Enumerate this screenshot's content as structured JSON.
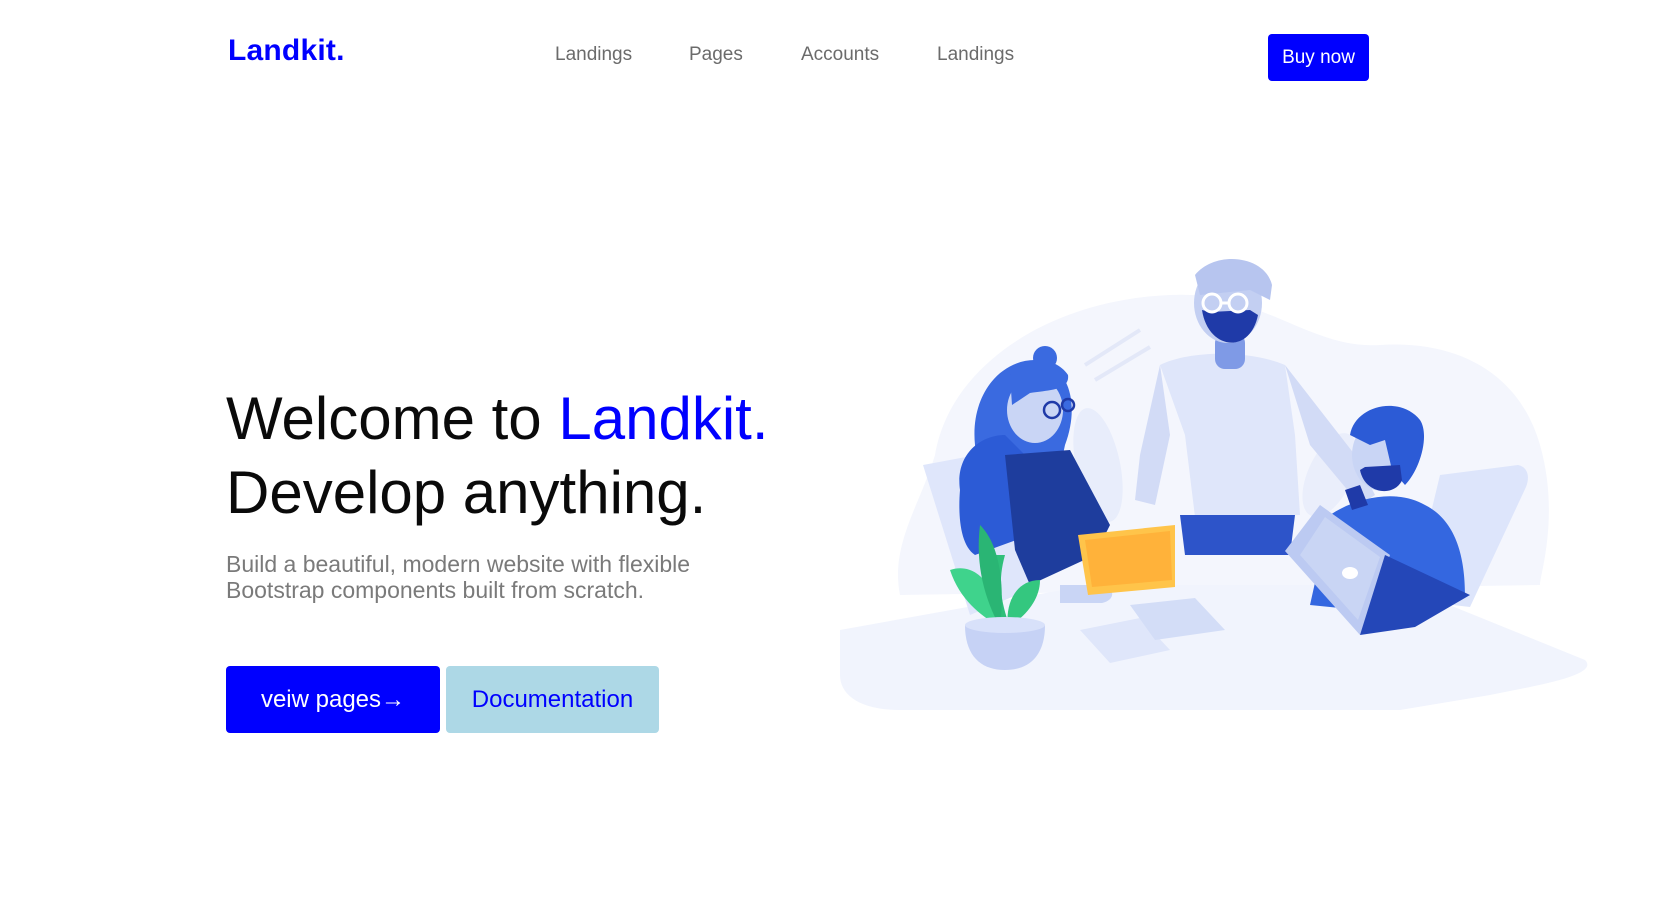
{
  "header": {
    "brand": "Landkit.",
    "nav": [
      {
        "label": "Landings"
      },
      {
        "label": "Pages"
      },
      {
        "label": "Accounts"
      },
      {
        "label": "Landings"
      }
    ],
    "buy_label": "Buy now"
  },
  "hero": {
    "title_prefix": "Welcome to ",
    "title_accent": "Landkit.",
    "title_line2": "Develop anything.",
    "subtitle": "Build a beautiful, modern website with flexible Bootstrap components built from scratch.",
    "primary_label": "veiw pages→",
    "secondary_label": "Documentation"
  },
  "colors": {
    "accent": "#0000ff",
    "secondary_bg": "#add8e6",
    "nav_text": "#6b6b6b",
    "subtitle_text": "#7a7a7a"
  },
  "illustration": {
    "icon": "team-working-illustration"
  }
}
